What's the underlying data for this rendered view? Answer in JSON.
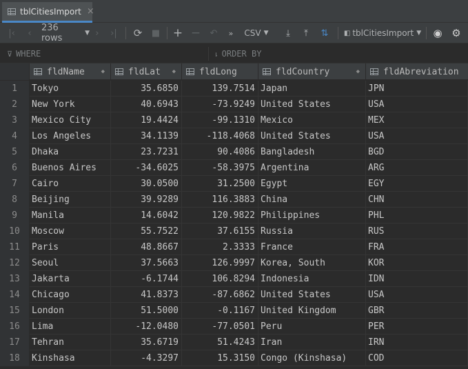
{
  "tab": {
    "title": "tblCitiesImport",
    "icon": "table-icon",
    "close": "×"
  },
  "toolbar": {
    "rows_label": "236 rows",
    "export_format": "CSV",
    "datasource": "tblCitiesImport"
  },
  "filter": {
    "where_label": "WHERE",
    "orderby_label": "ORDER BY"
  },
  "columns": [
    "fldName",
    "fldLat",
    "fldLong",
    "fldCountry",
    "fldAbreviation"
  ],
  "rows": [
    [
      "1",
      "Tokyo",
      "35.6850",
      "139.7514",
      "Japan",
      "JPN"
    ],
    [
      "2",
      "New York",
      "40.6943",
      "-73.9249",
      "United States",
      "USA"
    ],
    [
      "3",
      "Mexico City",
      "19.4424",
      "-99.1310",
      "Mexico",
      "MEX"
    ],
    [
      "4",
      "Los Angeles",
      "34.1139",
      "-118.4068",
      "United States",
      "USA"
    ],
    [
      "5",
      "Dhaka",
      "23.7231",
      "90.4086",
      "Bangladesh",
      "BGD"
    ],
    [
      "6",
      "Buenos Aires",
      "-34.6025",
      "-58.3975",
      "Argentina",
      "ARG"
    ],
    [
      "7",
      "Cairo",
      "30.0500",
      "31.2500",
      "Egypt",
      "EGY"
    ],
    [
      "8",
      "Beijing",
      "39.9289",
      "116.3883",
      "China",
      "CHN"
    ],
    [
      "9",
      "Manila",
      "14.6042",
      "120.9822",
      "Philippines",
      "PHL"
    ],
    [
      "10",
      "Moscow",
      "55.7522",
      "37.6155",
      "Russia",
      "RUS"
    ],
    [
      "11",
      "Paris",
      "48.8667",
      "2.3333",
      "France",
      "FRA"
    ],
    [
      "12",
      "Seoul",
      "37.5663",
      "126.9997",
      "Korea, South",
      "KOR"
    ],
    [
      "13",
      "Jakarta",
      "-6.1744",
      "106.8294",
      "Indonesia",
      "IDN"
    ],
    [
      "14",
      "Chicago",
      "41.8373",
      "-87.6862",
      "United States",
      "USA"
    ],
    [
      "15",
      "London",
      "51.5000",
      "-0.1167",
      "United Kingdom",
      "GBR"
    ],
    [
      "16",
      "Lima",
      "-12.0480",
      "-77.0501",
      "Peru",
      "PER"
    ],
    [
      "17",
      "Tehran",
      "35.6719",
      "51.4243",
      "Iran",
      "IRN"
    ],
    [
      "18",
      "Kinshasa",
      "-4.3297",
      "15.3150",
      "Congo (Kinshasa)",
      "COD"
    ]
  ]
}
